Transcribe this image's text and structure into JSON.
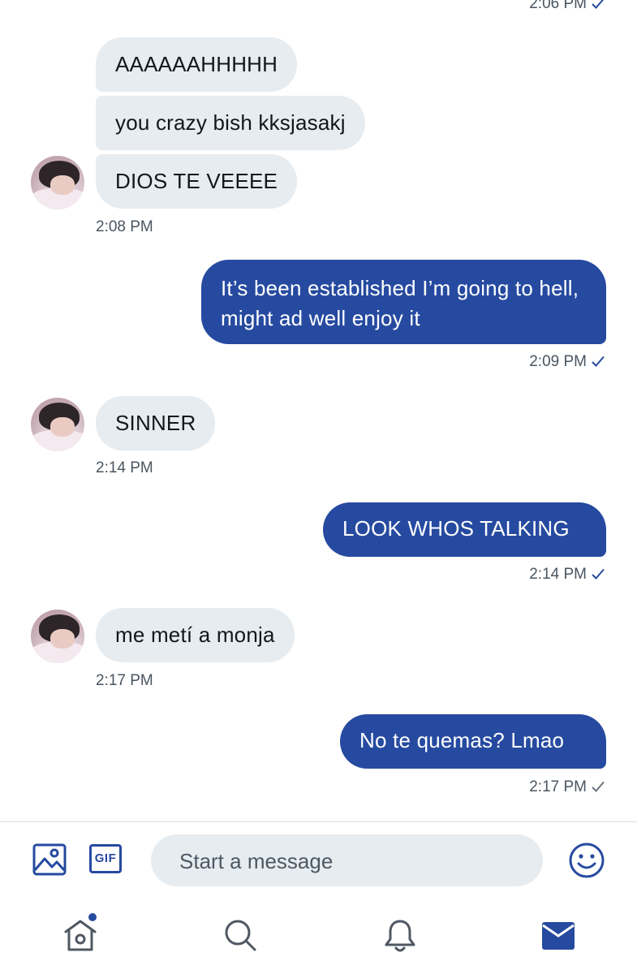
{
  "conversation": {
    "top_partial_time": "2:06 PM",
    "group1": {
      "messages": [
        "AAAAAAHHHHH",
        "you crazy bish kksjasakj",
        "DIOS TE VEEEE"
      ],
      "time": "2:08 PM"
    },
    "out1": {
      "text": "It’s been established I’m going to hell, might ad well enjoy it",
      "time": "2:09 PM"
    },
    "group2": {
      "messages": [
        "SINNER"
      ],
      "time": "2:14 PM"
    },
    "out2": {
      "text": "LOOK WHOS TALKING",
      "time": "2:14 PM"
    },
    "group3": {
      "messages": [
        "me metí a monja"
      ],
      "time": "2:17 PM"
    },
    "out3": {
      "text": "No te quemas? Lmao",
      "time": "2:17 PM"
    }
  },
  "composer": {
    "placeholder": "Start a message",
    "gif_label": "GIF"
  },
  "icons": {
    "media": "image-icon",
    "gif": "gif-icon",
    "emoji": "emoji-icon",
    "home": "home-icon",
    "search": "search-icon",
    "notifications": "bell-icon",
    "messages": "mail-icon",
    "sent_status": "checkmark-icon"
  },
  "colors": {
    "accent": "#264aa0",
    "incoming_bubble": "#e6ecf0",
    "timestamp": "#4a5560"
  }
}
